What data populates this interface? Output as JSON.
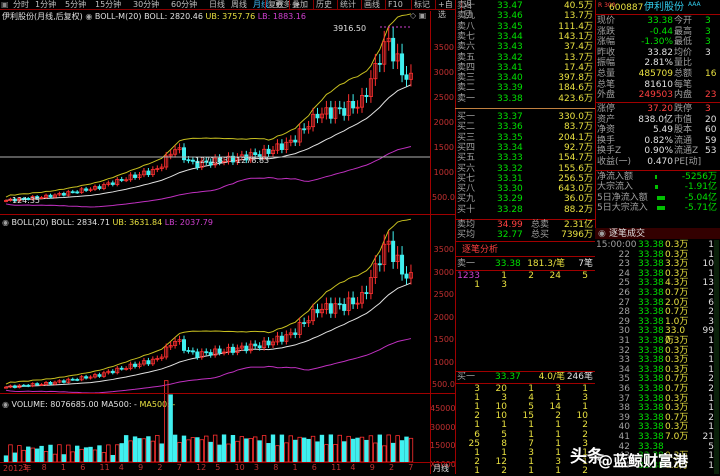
{
  "toolbar": {
    "periods": [
      "分时",
      "1分钟",
      "5分钟",
      "15分钟",
      "30分钟",
      "60分钟",
      "日线",
      "周线",
      "月线",
      "更多 >"
    ],
    "active": "月线",
    "actions": [
      "复权",
      "叠加",
      "历史",
      "统计",
      "画线",
      "F10",
      "标记",
      "+自选",
      "返回"
    ]
  },
  "main_chart": {
    "title": "伊利股份(月线,后复权)",
    "indicator": "BOLL-M(20)",
    "boll": "BOLL: 2820.46",
    "ub": "UB: 3757.76",
    "lb": "LB: 1883.16",
    "high_label": "3916.50",
    "low_label": "124.35",
    "range_label": "1271.83 - 1278.83",
    "axis": [
      "3500",
      "3000",
      "2500",
      "2000",
      "1500",
      "1000",
      "500.0"
    ]
  },
  "sub_chart": {
    "indicator": "BOLL(20)",
    "boll": "BOLL: 2834.71",
    "ub": "UB: 3631.84",
    "lb": "LB: 2037.79",
    "axis": [
      "3500",
      "3000",
      "2500",
      "2000",
      "1500",
      "1000",
      "500.0"
    ]
  },
  "volume_chart": {
    "label": "VOLUME: 8076685.00",
    "ma": "MA500: -",
    "ma2": "MA500: -",
    "axis": [
      "45000",
      "30000",
      "15000",
      "X1000"
    ]
  },
  "date_axis": {
    "labels": [
      "2012年",
      "3",
      "8",
      "1",
      "6",
      "11",
      "4",
      "9",
      "2",
      "7",
      "12",
      "5",
      "10",
      "3",
      "8",
      "1",
      "6",
      "11",
      "4",
      "9",
      "2",
      "7"
    ],
    "period": "月线"
  },
  "colors": {
    "up": "#ff3030",
    "down": "#40f0f0",
    "upper": "#c8c020",
    "mid": "#e0e0e0",
    "lower": "#c030c0"
  },
  "order_book": {
    "sells": [
      {
        "label": "卖十",
        "price": "33.47",
        "vol": "40.5万"
      },
      {
        "label": "卖九",
        "price": "33.46",
        "vol": "13.7万"
      },
      {
        "label": "卖八",
        "price": "33.45",
        "vol": "111.4万"
      },
      {
        "label": "卖七",
        "price": "33.44",
        "vol": "143.1万"
      },
      {
        "label": "卖六",
        "price": "33.43",
        "vol": "37.4万"
      },
      {
        "label": "卖五",
        "price": "33.42",
        "vol": "13.7万"
      },
      {
        "label": "卖四",
        "price": "33.41",
        "vol": "17.4万"
      },
      {
        "label": "卖三",
        "price": "33.40",
        "vol": "397.8万"
      },
      {
        "label": "卖二",
        "price": "33.39",
        "vol": "184.6万"
      },
      {
        "label": "卖一",
        "price": "33.38",
        "vol": "423.6万"
      }
    ],
    "buys": [
      {
        "label": "买一",
        "price": "33.37",
        "vol": "330.0万"
      },
      {
        "label": "买二",
        "price": "33.36",
        "vol": "83.7万"
      },
      {
        "label": "买三",
        "price": "33.35",
        "vol": "204.1万"
      },
      {
        "label": "买四",
        "price": "33.34",
        "vol": "92.7万"
      },
      {
        "label": "买五",
        "price": "33.33",
        "vol": "154.7万"
      },
      {
        "label": "买六",
        "price": "33.32",
        "vol": "155.6万"
      },
      {
        "label": "买七",
        "price": "33.31",
        "vol": "256.5万"
      },
      {
        "label": "买八",
        "price": "33.30",
        "vol": "643.0万"
      },
      {
        "label": "买九",
        "price": "33.29",
        "vol": "36.0万"
      },
      {
        "label": "买十",
        "price": "33.28",
        "vol": "88.2万"
      }
    ],
    "avg": [
      {
        "label": "卖均",
        "price": "34.99",
        "tl": "总卖",
        "tv": "2.31亿"
      },
      {
        "label": "买均",
        "price": "32.77",
        "tl": "总买",
        "tv": "7396万"
      }
    ]
  },
  "tick_analysis": {
    "title": "逐笔分析",
    "sell1": {
      "label": "卖一",
      "price": "33.38",
      "avg": "181.3/笔",
      "count": "7笔"
    },
    "sell_rows": [
      [
        "1233",
        "1",
        "2",
        "24",
        "5"
      ],
      [
        "1",
        "3",
        "",
        "",
        ""
      ]
    ],
    "buy1": {
      "label": "买一",
      "price": "33.37",
      "avg": "4.0/笔",
      "count": "246笔"
    },
    "buy_rows": [
      [
        "3",
        "20",
        "1",
        "3",
        "1"
      ],
      [
        "1",
        "3",
        "4",
        "1",
        "3"
      ],
      [
        "1",
        "10",
        "5",
        "14",
        "1"
      ],
      [
        "2",
        "10",
        "15",
        "2",
        "10"
      ],
      [
        "1",
        "1",
        "1",
        "1",
        "2"
      ],
      [
        "6",
        "5",
        "1",
        "1",
        "2"
      ],
      [
        "25",
        "8",
        "7",
        "1",
        "3"
      ],
      [
        "1",
        "1",
        "3",
        "1",
        "1"
      ],
      [
        "2",
        "12",
        "1",
        "3",
        "1"
      ],
      [
        "1",
        "2",
        "1",
        "1",
        "2"
      ]
    ]
  },
  "quote": {
    "market": "R 300",
    "code": "600887",
    "name": "伊利股份",
    "badge": "AAA",
    "rows": [
      [
        "现价",
        "33.38",
        "今开",
        "3"
      ],
      [
        "涨跌",
        "-0.44",
        "最高",
        "3"
      ],
      [
        "涨幅",
        "-1.30%",
        "最低",
        "3"
      ],
      [
        "昨收",
        "33.82",
        "均价",
        "3"
      ],
      [
        "振幅",
        "2.81%",
        "量比",
        ""
      ],
      [
        "总量",
        "485709",
        "总额",
        "16"
      ],
      [
        "总笔",
        "81610",
        "每笔",
        ""
      ],
      [
        "外盘",
        "249503",
        "内盘",
        "23"
      ]
    ],
    "rows2": [
      [
        "涨停",
        "37.20",
        "跌停",
        "3"
      ],
      [
        "资产",
        "838.0亿",
        "市值",
        "20"
      ],
      [
        "净资",
        "5.49",
        "股本",
        "60"
      ],
      [
        "换手",
        "0.82%",
        "流通",
        "59"
      ],
      [
        "换手Z",
        "0.90%",
        "流通Z",
        "53"
      ],
      [
        "收益(一)",
        "0.470",
        "PE[动]",
        ""
      ]
    ],
    "flows": [
      [
        "净流入额",
        "-5256万"
      ],
      [
        "大宗流入",
        "-1.91亿"
      ],
      [
        "5日净流入额",
        "-5.04亿"
      ],
      [
        "5日大宗流入",
        "-5.71亿"
      ]
    ]
  },
  "trades": {
    "title": "逐笔成交",
    "rows": [
      [
        "15:00:00",
        "33.38",
        "0.3万",
        "1"
      ],
      [
        "22",
        "33.38",
        "0.3万",
        "1"
      ],
      [
        "23",
        "33.38",
        "3.3万",
        "10"
      ],
      [
        "24",
        "33.38",
        "0.3万",
        "1"
      ],
      [
        "25",
        "33.38",
        "4.3万",
        "13"
      ],
      [
        "26",
        "33.38",
        "0.7万",
        "2"
      ],
      [
        "27",
        "33.38",
        "2.0万",
        "6"
      ],
      [
        "28",
        "33.38",
        "0.7万",
        "2"
      ],
      [
        "29",
        "33.38",
        "1.0万",
        "3"
      ],
      [
        "30",
        "33.38",
        "33.0万",
        "99"
      ],
      [
        "31",
        "33.38",
        "0.3万",
        "1"
      ],
      [
        "32",
        "33.38",
        "0.3万",
        "1"
      ],
      [
        "33",
        "33.38",
        "0.3万",
        "1"
      ],
      [
        "34",
        "33.38",
        "0.3万",
        "1"
      ],
      [
        "35",
        "33.38",
        "0.7万",
        "2"
      ],
      [
        "36",
        "33.38",
        "0.7万",
        "2"
      ],
      [
        "37",
        "33.38",
        "0.3万",
        "1"
      ],
      [
        "38",
        "33.38",
        "0.3万",
        "1"
      ],
      [
        "39",
        "33.38",
        "0.7万",
        "2"
      ],
      [
        "40",
        "33.38",
        "0.3万",
        "1"
      ],
      [
        "41",
        "33.38",
        "7.0万",
        "21"
      ],
      [
        "42",
        "33.38",
        "",
        "5"
      ],
      [
        "43",
        "33.38",
        "0.3万",
        "1"
      ],
      [
        "44",
        "33.38",
        "0.3万",
        "1"
      ]
    ]
  },
  "watermark": {
    "line1": "头条",
    "line2": "@蓝鲸财富港"
  }
}
